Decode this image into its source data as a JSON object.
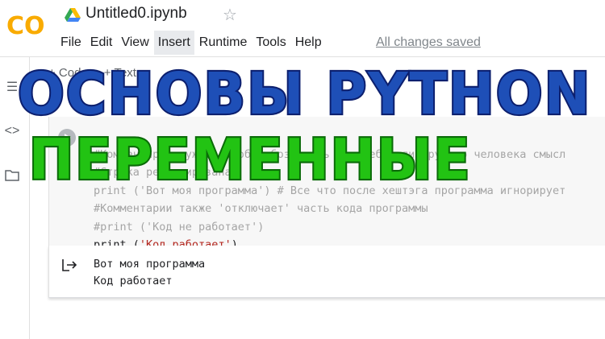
{
  "header": {
    "logo_text": "CO",
    "title": "Untitled0.ipynb",
    "saved_status": "All changes saved"
  },
  "menu": {
    "items": [
      {
        "label": "File"
      },
      {
        "label": "Edit"
      },
      {
        "label": "View"
      },
      {
        "label": "Insert"
      },
      {
        "label": "Runtime"
      },
      {
        "label": "Tools"
      },
      {
        "label": "Help"
      }
    ],
    "active": "Insert"
  },
  "toolbar": {
    "code_label": "+ Code",
    "text_label": "+ Text"
  },
  "cell": {
    "lines": [
      {
        "text": "#Комментарии нужны, чтобы обозначить для себя или другого человека смысл",
        "kind": "comment"
      },
      {
        "text": "#Строка ремонтирована",
        "kind": "comment"
      },
      {
        "text": "print ('Вот моя программа') # Все что после хештэга программа игнорирует",
        "kind": "comment"
      },
      {
        "text": "#Комментарии также 'отключает' часть кода программы",
        "kind": "comment"
      },
      {
        "text": "#print ('Код не работает')",
        "kind": "comment"
      },
      {
        "text_pre": "print (",
        "text_str": "'Код работает'",
        "text_post": ")",
        "kind": "code"
      }
    ]
  },
  "output": {
    "lines": [
      "Вот моя программа",
      "Код работает"
    ]
  },
  "overlay": {
    "line1": "ОСНОВЫ PYTHON",
    "line2": "ПЕРЕМЕННЫЕ"
  },
  "colors": {
    "overlay_blue": "#1e4fb7",
    "overlay_green": "#22c313",
    "logo_orange": "#f9ab00"
  }
}
